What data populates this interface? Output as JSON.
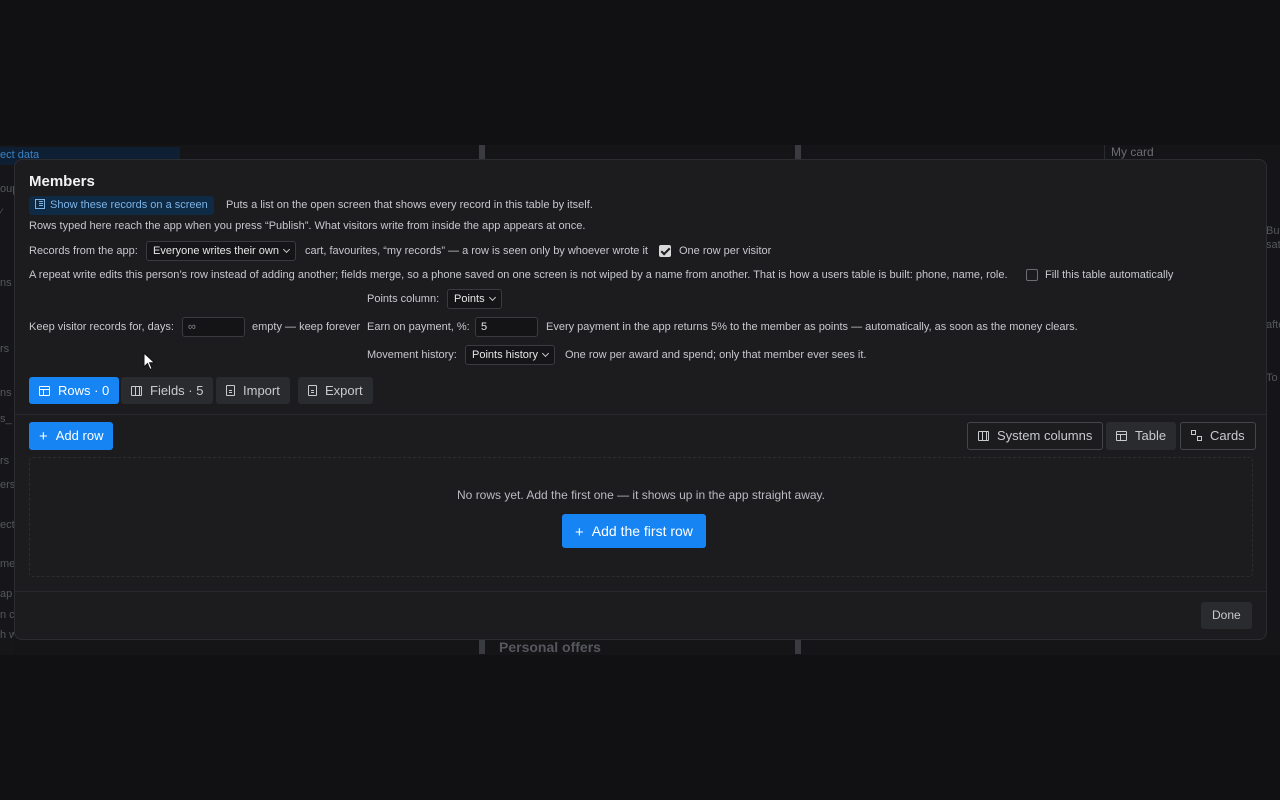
{
  "background": {
    "selected_fragment": "ect data",
    "left_fragments": [
      "oup",
      "ns",
      "rs",
      "ns",
      "s_",
      "rs",
      "ers",
      "ect",
      "me",
      "ap",
      "n ca",
      "h w"
    ],
    "right_fragments": [
      "Bu",
      "sat",
      "afte",
      "To"
    ],
    "my_card": "My card",
    "personal_offers": "Personal offers"
  },
  "modal": {
    "title": "Members",
    "show_chip": "Show these records on a screen",
    "show_desc": "Puts a list on the open screen that shows every record in this table by itself.",
    "publish_note": "Rows typed here reach the app when you press “Publish”. What visitors write from inside the app appears at once.",
    "records_label": "Records from the app:",
    "records_value": "Everyone writes their own",
    "records_desc": "cart, favourites, “my records” — a row is seen only by whoever wrote it",
    "one_row_label": "One row per visitor",
    "one_row_checked": true,
    "repeat_note": "A repeat write edits this person’s row instead of adding another; fields merge, so a phone saved on one screen is not wiped by a name from another. That is how a users table is built: phone, name, role.",
    "autofill_label": "Fill this table automatically",
    "autofill_checked": false,
    "keep_label": "Keep visitor records for, days:",
    "keep_value": "∞",
    "keep_desc": "empty — keep forever",
    "points_col_label": "Points column:",
    "points_col_value": "Points",
    "earn_label": "Earn on payment, %:",
    "earn_value": "5",
    "earn_desc": "Every payment in the app returns 5% to the member as points — automatically, as soon as the money clears.",
    "history_label": "Movement history:",
    "history_value": "Points history",
    "history_desc": "One row per award and spend; only that member ever sees it."
  },
  "tabs": [
    {
      "label": "Rows · 0",
      "icon": "table-icon",
      "active": true
    },
    {
      "label": "Fields · 5",
      "icon": "columns-icon",
      "active": false
    },
    {
      "label": "Import",
      "icon": "file-import-icon",
      "active": false
    },
    {
      "label": "Export",
      "icon": "file-export-icon",
      "active": false
    }
  ],
  "toolbar": {
    "add_row": "Add row",
    "system_columns": "System columns",
    "view_table": "Table",
    "view_cards": "Cards"
  },
  "empty_state": {
    "message": "No rows yet. Add the first one — it shows up in the app straight away.",
    "add_first": "Add the first row"
  },
  "footer": {
    "done": "Done"
  },
  "colors": {
    "accent": "#1684f3",
    "modal_bg": "#1c1c1f",
    "page_bg": "#111113"
  }
}
